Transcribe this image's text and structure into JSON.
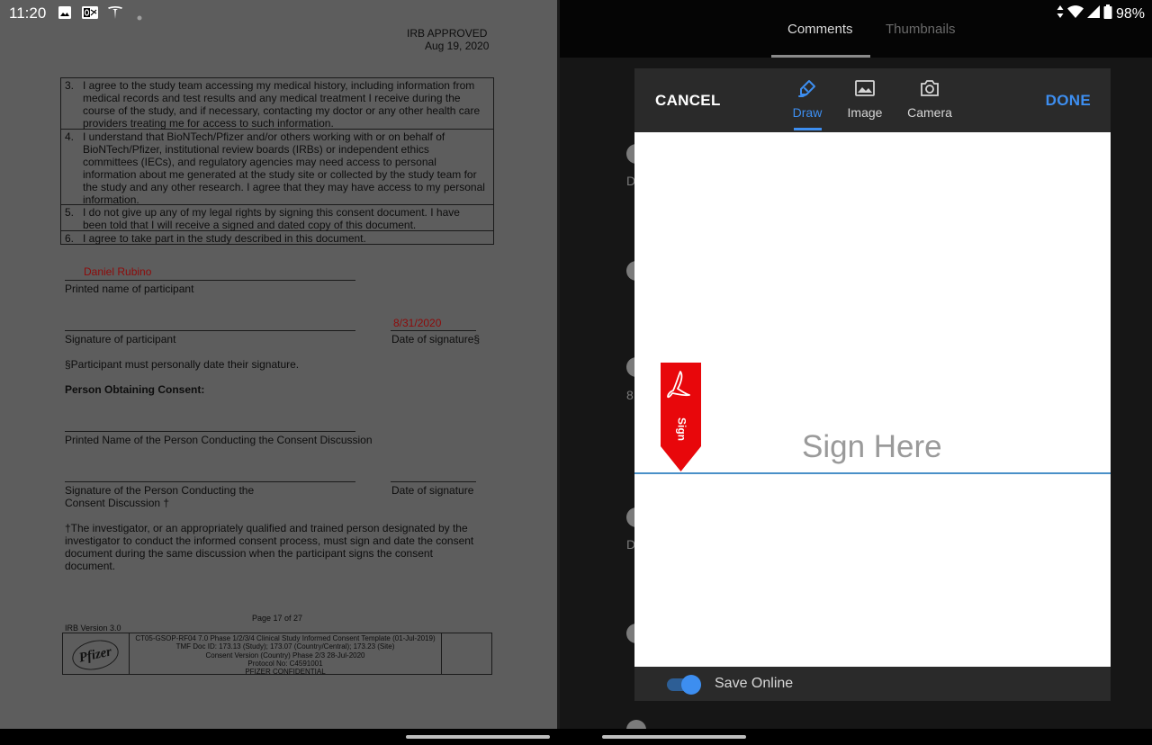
{
  "status_bar": {
    "time": "11:20",
    "left_icons": [
      "image-icon",
      "outlook-icon",
      "tesla-icon",
      "dot-icon"
    ],
    "battery": "98%",
    "right_icons": [
      "data-arrows-icon",
      "wifi-icon",
      "signal-icon",
      "battery-icon"
    ]
  },
  "document": {
    "irb_stamp": [
      "IRB APPROVED",
      "Aug 19, 2020"
    ],
    "consent_items": [
      {
        "num": "3.",
        "text": "I agree to the study team accessing my medical history, including information from medical records and test results and any medical treatment I receive during the course of the study, and if necessary, contacting my doctor or any other health care providers treating me for access to such information."
      },
      {
        "num": "4.",
        "text": "I understand that BioNTech/Pfizer and/or others working with or on behalf of BioNTech/Pfizer, institutional review boards (IRBs) or independent ethics committees (IECs), and regulatory agencies may need access to personal information about me generated at the study site or collected by the study team for the study and any other research. I agree that they may have access to my personal information."
      },
      {
        "num": "5.",
        "text": "I do not give up any of my legal rights by signing this consent document. I have been told that I will receive a signed and dated copy of this document."
      },
      {
        "num": "6.",
        "text": "I agree to take part in the study described in this document."
      }
    ],
    "participant_name": "Daniel Rubino",
    "printed_name_label": "Printed name of participant",
    "signature_date": "8/31/2020",
    "signature_label": "Signature of participant",
    "date_label": "Date of signature§",
    "date_note": "§Participant must personally date their signature.",
    "person_obtaining_heading": "Person Obtaining Consent:",
    "printed_name_person_label": "Printed Name of the Person Conducting the Consent Discussion",
    "signature_person_label_1": "Signature of the Person Conducting the",
    "signature_person_label_2": "Consent Discussion †",
    "date_of_signature_label": "Date of signature",
    "investigator_note": "†The investigator, or an appropriately qualified and trained person designated by the investigator to conduct the informed consent process, must sign and date the consent document during the same discussion when the participant signs the consent document.",
    "page_number": "Page 17 of 27",
    "irb_version": "IRB Version 3.0",
    "logo_text": "Pfizer",
    "footer_lines": [
      "CT05-GSOP-RF04 7.0 Phase 1/2/3/4 Clinical Study Informed Consent Template (01-Jul-2019)",
      "TMF Doc ID: 173.13 (Study); 173.07 (Country/Central); 173.23 (Site)",
      "Consent Version (Country) Phase 2/3 28-Jul-2020",
      "Protocol No: C4591001",
      "PFIZER CONFIDENTIAL"
    ]
  },
  "right_panel": {
    "tabs": [
      "Comments",
      "Thumbnails"
    ],
    "active_tab": "Comments",
    "background_letters": [
      "D",
      "8",
      "D"
    ]
  },
  "signature_dialog": {
    "cancel_label": "CANCEL",
    "done_label": "DONE",
    "modes": [
      {
        "label": "Draw",
        "icon": "pen-icon"
      },
      {
        "label": "Image",
        "icon": "image-icon"
      },
      {
        "label": "Camera",
        "icon": "camera-icon"
      }
    ],
    "active_mode": "Draw",
    "sign_here_placeholder": "Sign Here",
    "flag_label": "Sign",
    "save_online_label": "Save Online",
    "save_online_enabled": true,
    "accent_color": "#3d8ef0",
    "flag_color": "#e8070b"
  }
}
